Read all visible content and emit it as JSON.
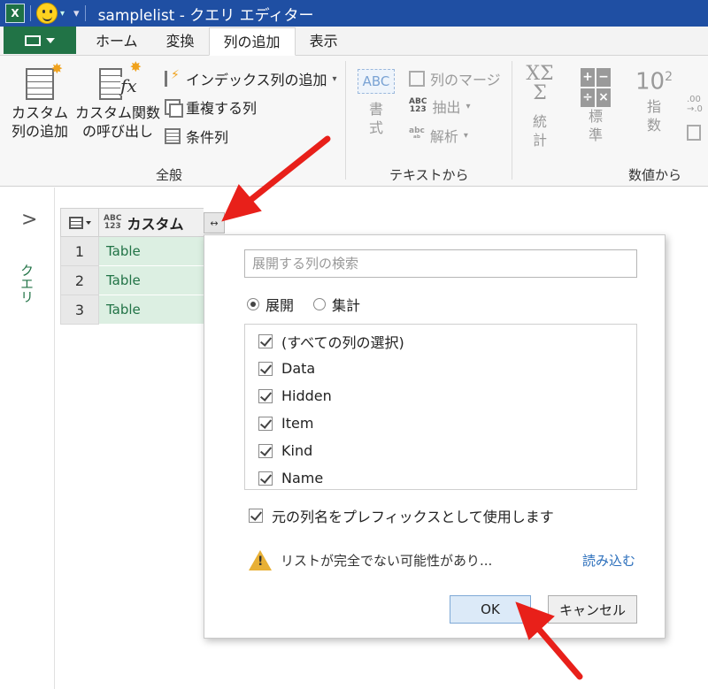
{
  "titlebar": {
    "file_title": "samplelist - クエリ エディター"
  },
  "ribbon_tabs": [
    {
      "label": "ホーム"
    },
    {
      "label": "変換"
    },
    {
      "label": "列の追加"
    },
    {
      "label": "表示"
    }
  ],
  "ribbon": {
    "general": {
      "custom_column": [
        "カスタム",
        "列の追加"
      ],
      "invoke_custom_function": [
        "カスタム関数",
        "の呼び出し"
      ],
      "index_column": "インデックス列の追加",
      "duplicate_column": "重複する列",
      "conditional_column": "条件列",
      "group_label": "全般"
    },
    "text": {
      "format": [
        "書",
        "式"
      ],
      "merge_columns": "列のマージ",
      "extract": "抽出",
      "parse": "解析",
      "abc_badge": "ABC",
      "abc123_badge": [
        "ABC",
        "123"
      ],
      "group_label": "テキストから"
    },
    "number": {
      "statistics": [
        "統",
        "計"
      ],
      "standard": [
        "標",
        "準"
      ],
      "scientific": [
        "指",
        "数"
      ],
      "statistics_symbol": [
        "XΣ",
        "Σ"
      ],
      "scientific_symbol": "10",
      "scientific_exp": "2",
      "small_icon_text": ".00\n→.0",
      "group_label": "数値から"
    }
  },
  "side": {
    "queries_label": "クエリ",
    "expand_chevron": ">"
  },
  "grid": {
    "column_type_badge": [
      "ABC",
      "123"
    ],
    "column_name": "カスタム",
    "expand_button_text": "↔",
    "rows": [
      {
        "num": "1",
        "value": "Table"
      },
      {
        "num": "2",
        "value": "Table"
      },
      {
        "num": "3",
        "value": "Table"
      }
    ]
  },
  "dialog": {
    "search_placeholder": "展開する列の検索",
    "search_value": "",
    "mode_expand": "展開",
    "mode_aggregate": "集計",
    "selected_mode": "展開",
    "columns": [
      {
        "label": "(すべての列の選択)",
        "checked": true
      },
      {
        "label": "Data",
        "checked": true
      },
      {
        "label": "Hidden",
        "checked": true
      },
      {
        "label": "Item",
        "checked": true
      },
      {
        "label": "Kind",
        "checked": true
      },
      {
        "label": "Name",
        "checked": true
      }
    ],
    "use_prefix_label": "元の列名をプレフィックスとして使用します",
    "use_prefix_checked": true,
    "warning_text": "リストが完全でない可能性があり...",
    "load_more_link": "読み込む",
    "ok_label": "OK",
    "cancel_label": "キャンセル"
  },
  "colors": {
    "title_bar": "#1f4fa3",
    "excel_green": "#217346",
    "row_highlight": "#dcefe2",
    "link_blue": "#2a6ebb",
    "annotation_red": "#e8201a"
  }
}
